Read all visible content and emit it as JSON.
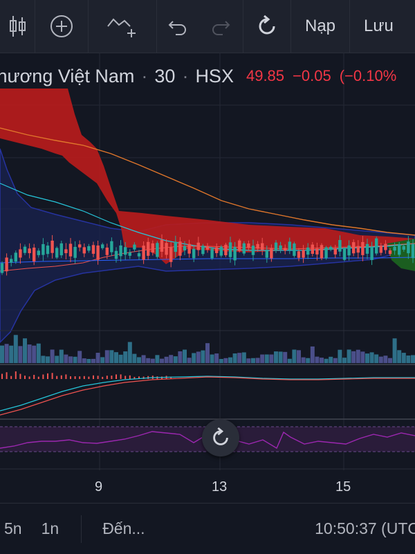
{
  "toolbar": {
    "reload_label": "Nạp",
    "save_label": "Lưu"
  },
  "legend": {
    "symbol_name": "thương Việt Nam",
    "interval": "30",
    "exchange": "HSX",
    "last_price": "49.85",
    "change": "−0.05",
    "change_pct": "(−0.10%"
  },
  "xaxis": {
    "labels": [
      "9",
      "13",
      "15"
    ]
  },
  "bottombar": {
    "range_5d": "5n",
    "range_1d": "1n",
    "goto": "Đến...",
    "clock": "10:50:37 (UTC"
  },
  "colors": {
    "background": "#131722",
    "up": "#26a69a",
    "down": "#ef5350",
    "cloud_bearish": "#b71c1c",
    "cloud_bullish": "#1b5e20",
    "rsi_line": "#9c27b0",
    "volume_up": "#2e6f88",
    "volume_down": "#4b4f8a"
  }
}
